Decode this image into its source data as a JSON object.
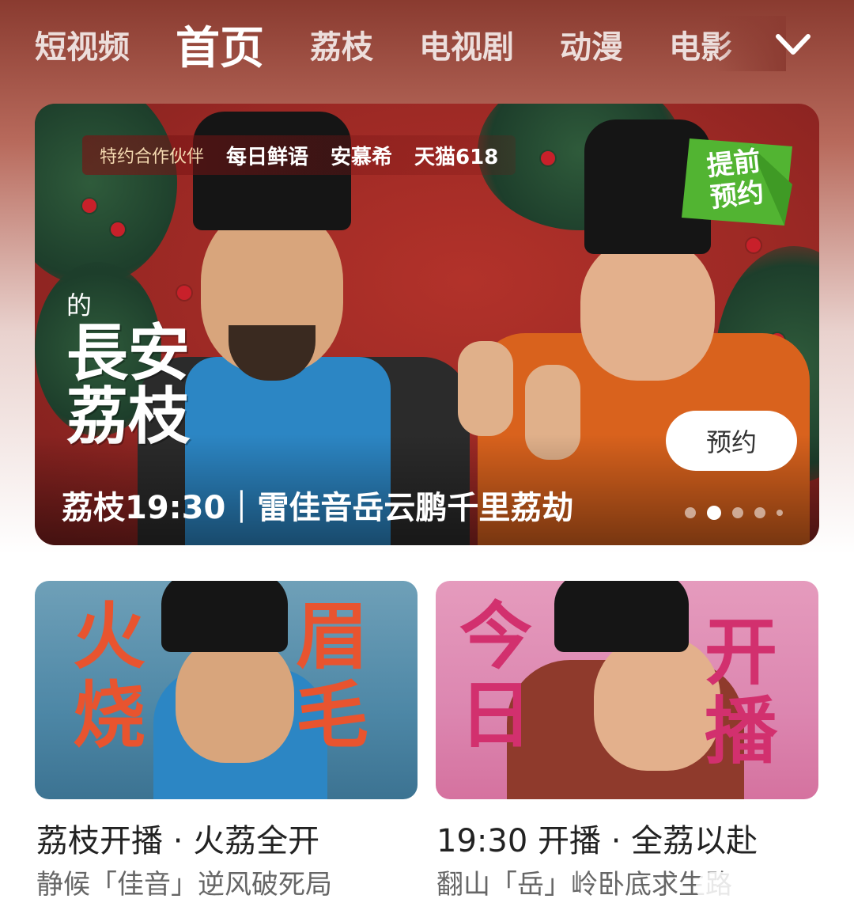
{
  "nav": {
    "tabs": [
      "短视频",
      "首页",
      "荔枝",
      "电视剧",
      "动漫",
      "电影"
    ],
    "active_index": 1,
    "more_icon": "chevron-down-icon"
  },
  "hero": {
    "sponsor_label": "特约合作伙伴",
    "sponsors": [
      "每日鲜语",
      "安慕希",
      "天猫618"
    ],
    "badge": "提前预约",
    "title_small": "的",
    "title_big_1": "長安",
    "title_big_2": "荔枝",
    "reserve_button": "预约",
    "caption": "荔枝19:30｜雷佳音岳云鹏千里荔劫",
    "pagination_total": 5,
    "pagination_active": 2
  },
  "cards": [
    {
      "art_text_left": "火烧",
      "art_text_right": "眉毛",
      "title": "荔枝开播 · 火荔全开",
      "subtitle": "静候「佳音」逆风破死局"
    },
    {
      "art_text_left": "今日",
      "art_text_right": "开播",
      "title": "19:30 开播 · 全荔以赴",
      "subtitle": "翻山「岳」岭卧底求生路"
    }
  ],
  "colors": {
    "hero_bg": "#9a2824",
    "badge_green": "#52b432",
    "card_left_text": "#e8542f",
    "card_right_text": "#d2306e"
  }
}
